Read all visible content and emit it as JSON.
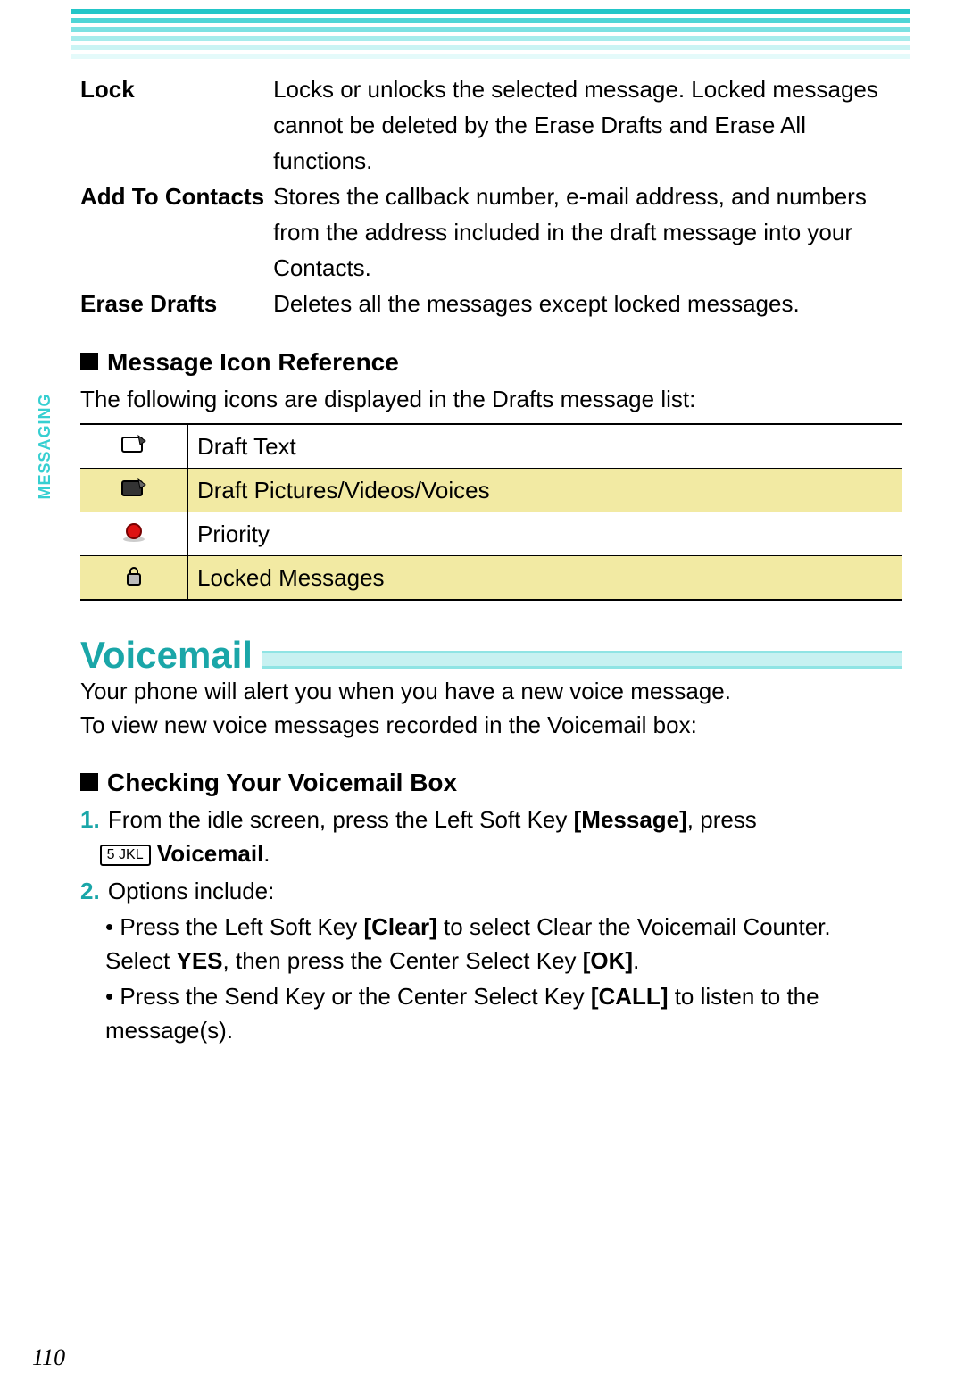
{
  "sidebar_label": "MESSAGING",
  "definitions": [
    {
      "term": "Lock",
      "desc": "Locks or unlocks the selected message. Locked messages cannot be deleted by the Erase Drafts and Erase All functions."
    },
    {
      "term": "Add To Contacts",
      "desc": "Stores the callback number, e-mail address, and numbers from the address included in the draft message into your Contacts."
    },
    {
      "term": "Erase Drafts",
      "desc": "Deletes all the messages except locked messages."
    }
  ],
  "icon_ref": {
    "heading": "Message Icon Reference",
    "intro": "The following icons are displayed in the Drafts message list:",
    "rows": [
      {
        "icon": "draft-text-icon",
        "label": "Draft Text"
      },
      {
        "icon": "draft-media-icon",
        "label": "Draft Pictures/Videos/Voices"
      },
      {
        "icon": "priority-icon",
        "label": "Priority"
      },
      {
        "icon": "lock-icon",
        "label": "Locked Messages"
      }
    ]
  },
  "voicemail": {
    "title": "Voicemail",
    "intro": "Your phone will alert you when you have a new voice message.\nTo view new voice messages recorded in the Voicemail box:",
    "sub": "Checking Your Voicemail Box",
    "step1_a": "From the idle screen, press the Left Soft Key ",
    "step1_b_bold": "[Message]",
    "step1_c": ", press",
    "step1_key": "5 JKL",
    "step1_end_bold": "Voicemail",
    "step1_end": ".",
    "step2_lead": "Options include:",
    "opt1_a": "Press the Left Soft Key ",
    "opt1_b_bold": "[Clear]",
    "opt1_c": " to select Clear the Voicemail Counter. Select ",
    "opt1_d_bold": "YES",
    "opt1_e": ", then press the Center Select Key ",
    "opt1_f_bold": "[OK]",
    "opt1_g": ".",
    "opt2_a": "Press the Send Key or the Center Select Key ",
    "opt2_b_bold": "[CALL]",
    "opt2_c": " to listen to the message(s)."
  },
  "page_number": "110"
}
